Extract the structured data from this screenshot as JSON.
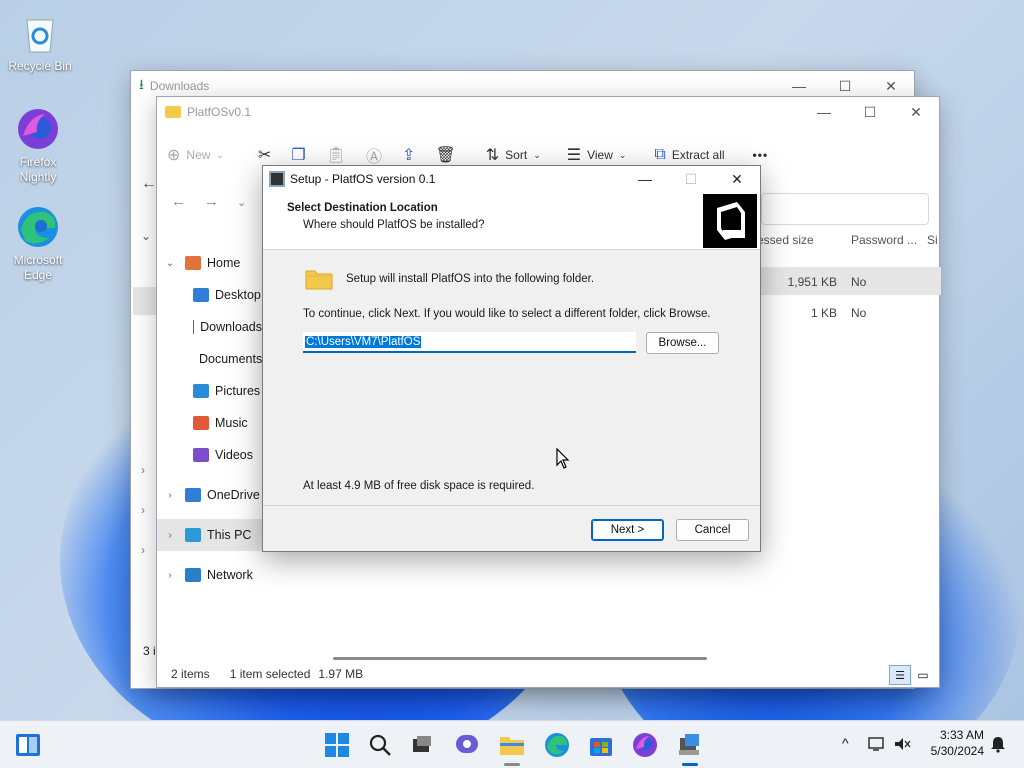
{
  "desktop": {
    "icons": [
      {
        "label": "Recycle Bin"
      },
      {
        "label": "Firefox Nightly"
      },
      {
        "label": "Microsoft Edge"
      }
    ]
  },
  "downloads_window": {
    "title": "Downloads"
  },
  "explorer": {
    "title": "PlatfOSv0.1",
    "toolbar": {
      "new_label": "New",
      "sort_label": "Sort",
      "view_label": "View",
      "extract_label": "Extract all",
      "more_label": "•••"
    },
    "sidebar": [
      {
        "label": "Home",
        "chevron": "⌄",
        "icon_color": "#e2733a"
      },
      {
        "label": "Desktop",
        "icon_color": "#2f7fd8"
      },
      {
        "label": "Downloads",
        "icon_color": "#1f8a4c"
      },
      {
        "label": "Documents",
        "icon_color": "#6b7c93"
      },
      {
        "label": "Pictures",
        "icon_color": "#2a8bd6"
      },
      {
        "label": "Music",
        "icon_color": "#e05a3a"
      },
      {
        "label": "Videos",
        "icon_color": "#7b4fc9"
      },
      {
        "label": "OneDrive",
        "chevron": "›",
        "icon_color": "#2f7fd8"
      },
      {
        "label": "This PC",
        "chevron": "›",
        "icon_color": "#2a9bd8"
      },
      {
        "label": "Network",
        "chevron": "›",
        "icon_color": "#2a7fc8"
      }
    ],
    "columns": {
      "compressed": "essed size",
      "password": "Password ...",
      "size": "Si"
    },
    "files": [
      {
        "size": "1,951 KB",
        "password": "No"
      },
      {
        "size": "1 KB",
        "password": "No"
      }
    ],
    "status": {
      "items": "2 items",
      "selected": "1 item selected",
      "size": "1.97 MB"
    },
    "left_fragment": "3 i"
  },
  "setup": {
    "title": "Setup - PlatfOS version 0.1",
    "heading": "Select Destination Location",
    "subheading": "Where should PlatfOS be installed?",
    "install_text": "Setup will install PlatfOS into the following folder.",
    "continue_text": "To continue, click Next. If you would like to select a different folder, click Browse.",
    "path_value": "C:\\Users\\VM7\\PlatfOS",
    "browse_label": "Browse...",
    "disk_text": "At least 4.9 MB of free disk space is required.",
    "next_label": "Next >",
    "cancel_label": "Cancel"
  },
  "taskbar": {
    "time": "3:33 AM",
    "date": "5/30/2024",
    "chevron": "^"
  },
  "colors": {
    "accent": "#0067c0",
    "selection": "#0078d7"
  }
}
